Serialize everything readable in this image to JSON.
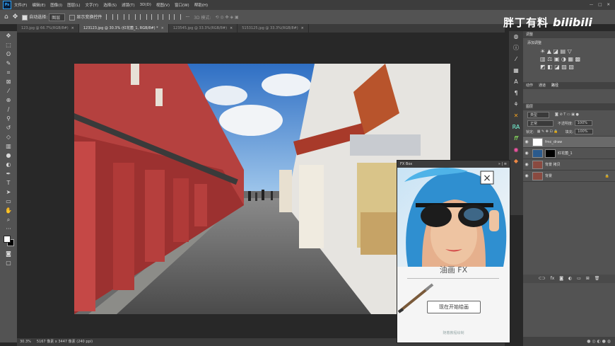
{
  "menubar": {
    "app_icon": "Ps",
    "items": [
      "文件(F)",
      "编辑(E)",
      "图像(I)",
      "图层(L)",
      "文字(Y)",
      "选择(S)",
      "滤镜(T)",
      "3D(D)",
      "视图(V)",
      "窗口(W)",
      "帮助(H)"
    ]
  },
  "options": {
    "auto_select": "自动选择:",
    "select_value": "图层",
    "show_transform": "显示变换控件",
    "mode3d": "3D 模式:"
  },
  "tabs": [
    {
      "label": "123.jpg @ 66.7%(RGB/8#)",
      "active": false
    },
    {
      "label": "123123.jpg @ 30.3% (红花菌_1, RGB/8#) *",
      "active": true
    },
    {
      "label": "123545.jpg @ 33.3%(RGB/8#)",
      "active": false
    },
    {
      "label": "5153125.jpg @ 33.3%(RGB/8#)",
      "active": false
    }
  ],
  "status": {
    "zoom": "30.3%",
    "doc": "5167 像素 x 3447 像素 (240 ppi)"
  },
  "watermark": {
    "text": "胖丁有料",
    "logo": "bilibili"
  },
  "panels": {
    "tabs_top": [
      "调整"
    ],
    "adjust_label": "添加调整",
    "tabs_mid": [
      "动作",
      "通道",
      "路径"
    ],
    "layers_tab": "图层",
    "kind_label": "类型",
    "blend_mode": "正常",
    "opacity_label": "不透明度:",
    "opacity_value": "100%",
    "lock_label": "锁定:",
    "fill_label": "填充:",
    "fill_value": "100%",
    "layers": [
      {
        "name": "fmc_draw",
        "selected": true,
        "lock": false
      },
      {
        "name": "红花菌_1",
        "selected": false,
        "lock": false
      },
      {
        "name": "背景 拷贝",
        "selected": false,
        "lock": false
      },
      {
        "name": "背景",
        "selected": false,
        "lock": true
      }
    ]
  },
  "fxbox": {
    "title": "FX Box",
    "controls": "» | ≡",
    "product": "油画 FX",
    "button": "现在开始绘画",
    "link": "随着教程绘制"
  },
  "colors": {
    "accent": "#31a8ff",
    "chrome": "#535353",
    "dark": "#282828"
  }
}
